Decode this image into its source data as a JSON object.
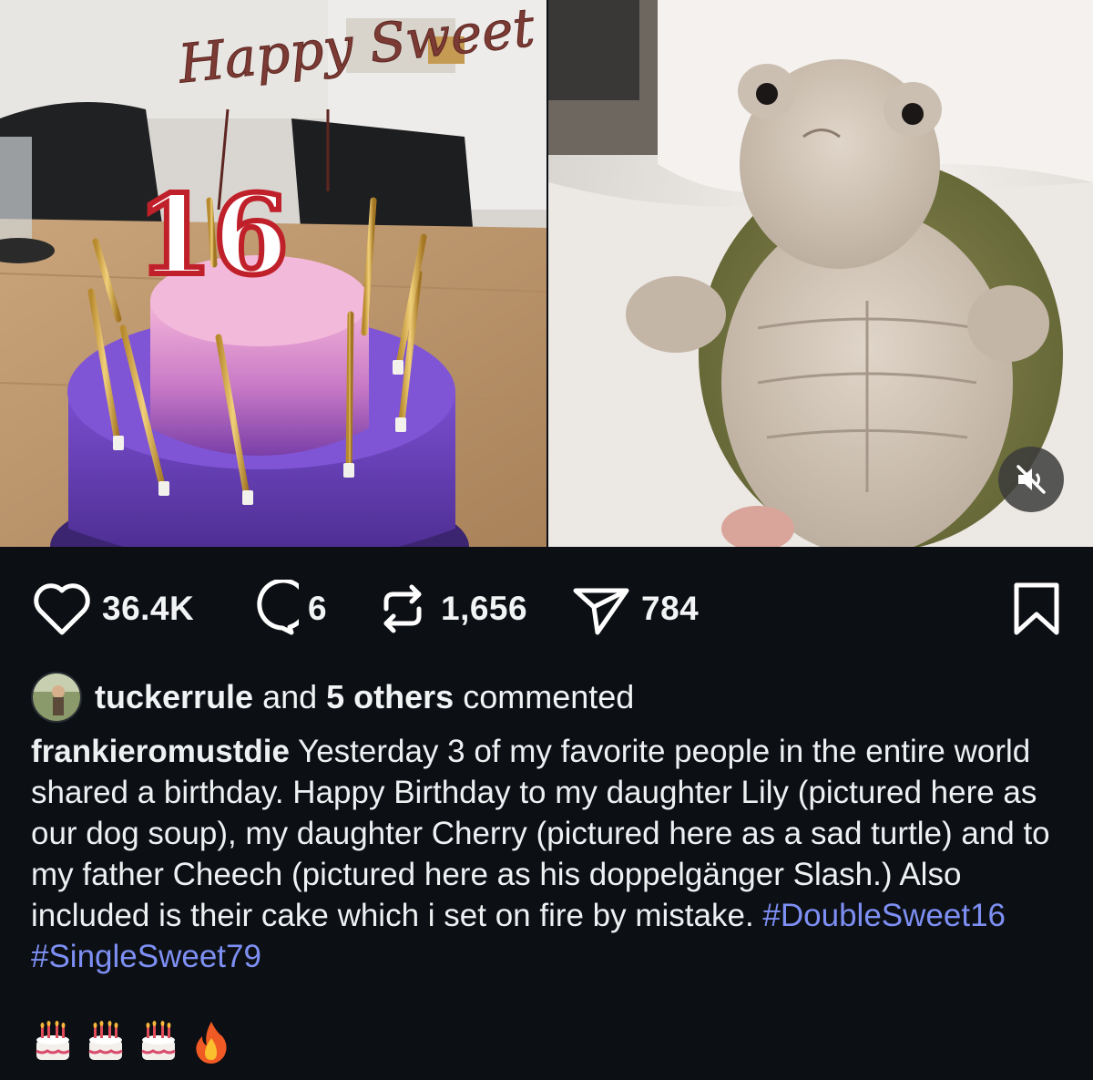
{
  "media": {
    "left_image": "birthday-cake-photo",
    "cake_topper_text": "Happy Sweet",
    "candle_number": "16",
    "right_image": "plush-turtle-photo",
    "mute_icon": "speaker-muted-icon"
  },
  "actions": {
    "likes": "36.4K",
    "comments": "6",
    "reposts": "1,656",
    "shares": "784"
  },
  "commenters": {
    "user": "tuckerrule",
    "and_text": " and ",
    "others": "5 others",
    "suffix": " commented"
  },
  "caption": {
    "username": "frankieromustdie",
    "text": " Yesterday 3 of my favorite people in the entire world shared a birthday. Happy Birthday to my daughter Lily (pictured here as our dog soup), my daughter Cherry (pictured here as a sad turtle) and to my father Cheech (pictured here as his doppelgänger Slash.) Also included is their cake which i set on fire by mistake. ",
    "hashtag1": "#DoubleSweet16",
    "hashtag2": "#SingleSweet79"
  },
  "emojis": [
    "birthday-cake-emoji",
    "birthday-cake-emoji",
    "birthday-cake-emoji",
    "fire-emoji"
  ],
  "colors": {
    "background": "#0c0f14",
    "text": "#f2f3f5",
    "hashtag": "#7d8ff3"
  }
}
